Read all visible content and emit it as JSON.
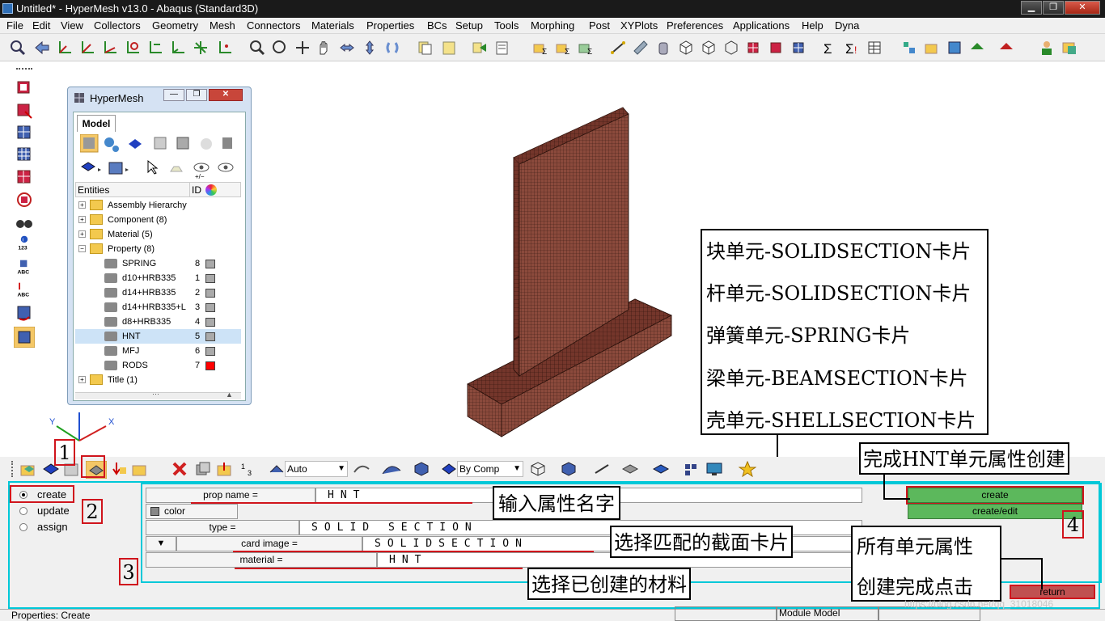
{
  "window": {
    "title": "Untitled* - HyperMesh v13.0 - Abaqus (Standard3D)",
    "minimize": "▁",
    "maximize": "❐",
    "close": "✕"
  },
  "menu": [
    "File",
    "Edit",
    "View",
    "Collectors",
    "Geometry",
    "Mesh",
    "Connectors",
    "Materials",
    "Properties",
    "BCs",
    "Setup",
    "Tools",
    "Morphing",
    "Post",
    "XYPlots",
    "Preferences",
    "Applications",
    "Help",
    "Dyna"
  ],
  "hm_window": {
    "title": "HyperMesh",
    "tab": "Model",
    "entities_header": "Entities",
    "id_header": "ID",
    "tree": [
      {
        "label": "Assembly Hierarchy",
        "id": "",
        "level": 0,
        "kind": "folder"
      },
      {
        "label": "Component (8)",
        "id": "",
        "level": 0,
        "kind": "folder"
      },
      {
        "label": "Material (5)",
        "id": "",
        "level": 0,
        "kind": "folder"
      },
      {
        "label": "Property (8)",
        "id": "",
        "level": 0,
        "kind": "folder"
      },
      {
        "label": "SPRING",
        "id": "8",
        "level": 1,
        "kind": "prop"
      },
      {
        "label": "d10+HRB335",
        "id": "1",
        "level": 1,
        "kind": "prop"
      },
      {
        "label": "d14+HRB335",
        "id": "2",
        "level": 1,
        "kind": "prop"
      },
      {
        "label": "d14+HRB335+L",
        "id": "3",
        "level": 1,
        "kind": "prop"
      },
      {
        "label": "d8+HRB335",
        "id": "4",
        "level": 1,
        "kind": "prop"
      },
      {
        "label": "HNT",
        "id": "5",
        "level": 1,
        "kind": "prop"
      },
      {
        "label": "MFJ",
        "id": "6",
        "level": 1,
        "kind": "prop"
      },
      {
        "label": "RODS",
        "id": "7",
        "level": 1,
        "kind": "prop"
      },
      {
        "label": "Title (1)",
        "id": "",
        "level": 0,
        "kind": "folder"
      }
    ],
    "selected_row_index": 9,
    "rods_color": "#ff0000",
    "gray_color": "#aaaaaa"
  },
  "axis": {
    "y": "Y",
    "x": "X",
    "z": "Z"
  },
  "left_toolbar_labels": {
    "n123": "123",
    "abc1": "ABC",
    "abc2": "ABC"
  },
  "callout_list": [
    "块单元-SOLIDSECTION卡片",
    "杆单元-SOLIDSECTION卡片",
    "弹簧单元-SPRING卡片",
    "梁单元-BEAMSECTION卡片",
    "壳单元-SHELLSECTION卡片"
  ],
  "callouts": {
    "finish_hnt": "完成HNT单元属性创建",
    "input_name": "输入属性名字",
    "select_card": "选择匹配的截面卡片",
    "select_material": "选择已创建的材料",
    "all_done_line1": "所有单元属性",
    "all_done_line2": "创建完成点击"
  },
  "markers": {
    "m1": "1",
    "m2": "2",
    "m3": "3",
    "m4": "4"
  },
  "bottom_toolbar": {
    "auto": "Auto",
    "by_comp": "By Comp"
  },
  "panel": {
    "radios": [
      {
        "label": "create",
        "checked": true
      },
      {
        "label": "update",
        "checked": false
      },
      {
        "label": "assign",
        "checked": false
      }
    ],
    "prop_name_label": "prop name =",
    "prop_name_value": "HNT",
    "color_label": "color",
    "type_label": "type =",
    "type_value": "SOLID SECTION",
    "card_image_label": "card image =",
    "card_image_value": "SOLIDSECTION",
    "material_label": "material =",
    "material_value": "HNT",
    "create_button": "create",
    "create_edit_button": "create/edit",
    "return_button": "return"
  },
  "status": {
    "left": "Properties: Create",
    "module": "Module Model",
    "watermark": "https://blog.csdn.net/qq_31018046"
  },
  "colors": {
    "mesh": "#8b4a3c",
    "accent_red": "#d0141c",
    "panel_outline": "#00c8d8",
    "green": "#5cb85c",
    "return": "#c05050"
  }
}
